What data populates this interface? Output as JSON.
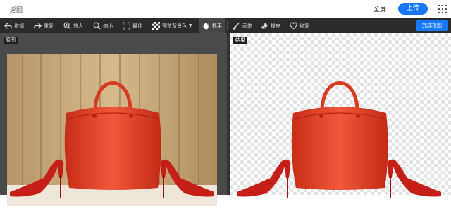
{
  "header": {
    "back_label": "返回",
    "fullscreen_label": "全屏",
    "upload_label": "上传"
  },
  "toolbar": {
    "undo_label": "撤销",
    "redo_label": "重复",
    "zoom_in_label": "放大",
    "zoom_out_label": "缩小",
    "fit_label": "最佳",
    "preview_bg_label": "预览背景色",
    "grab_label": "抓手",
    "brush_label": "画笔",
    "eraser_label": "橡皮",
    "repair_label": "修复",
    "finish_label": "完成抠图",
    "icons": [
      "undo-icon",
      "redo-icon",
      "zoom-in-icon",
      "zoom-out-icon",
      "fit-icon",
      "checker-icon",
      "hand-icon",
      "brush-icon",
      "eraser-icon",
      "repair-icon"
    ]
  },
  "panels": {
    "original_label": "原图",
    "result_label": "结果"
  },
  "colors": {
    "accent": "#1677ff",
    "toolbar_bg": "#2b2b2b",
    "panel_bg": "#4a4a4a",
    "bag": "#e8442a",
    "wood": "#c9a97a"
  }
}
